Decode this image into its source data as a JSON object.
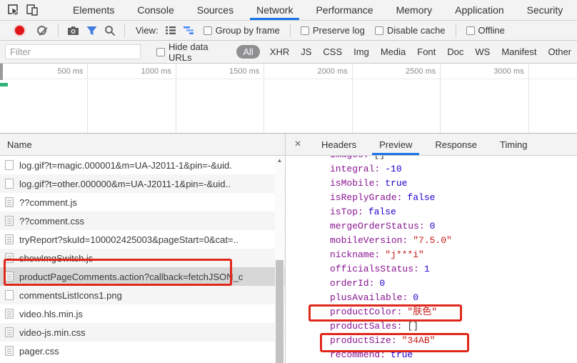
{
  "devtools": {
    "top_tabs": {
      "items": [
        {
          "label": "Elements",
          "state": ""
        },
        {
          "label": "Console",
          "state": ""
        },
        {
          "label": "Sources",
          "state": ""
        },
        {
          "label": "Network",
          "state": "active"
        },
        {
          "label": "Performance",
          "state": ""
        },
        {
          "label": "Memory",
          "state": ""
        },
        {
          "label": "Application",
          "state": ""
        },
        {
          "label": "Security",
          "state": ""
        }
      ]
    },
    "toolbar": {
      "view_label": "View:",
      "group_by_frame": "Group by frame",
      "preserve_log": "Preserve log",
      "disable_cache": "Disable cache",
      "offline": "Offline"
    },
    "filter_bar": {
      "placeholder": "Filter",
      "hide_data_urls": "Hide data URLs",
      "types": {
        "items": [
          {
            "label": "All",
            "state": "active-pill"
          },
          {
            "label": "XHR",
            "state": ""
          },
          {
            "label": "JS",
            "state": ""
          },
          {
            "label": "CSS",
            "state": ""
          },
          {
            "label": "Img",
            "state": ""
          },
          {
            "label": "Media",
            "state": ""
          },
          {
            "label": "Font",
            "state": ""
          },
          {
            "label": "Doc",
            "state": ""
          },
          {
            "label": "WS",
            "state": ""
          },
          {
            "label": "Manifest",
            "state": ""
          },
          {
            "label": "Other",
            "state": ""
          }
        ]
      }
    },
    "timeline": {
      "labels": {
        "items": [
          "500 ms",
          "1000 ms",
          "1500 ms",
          "2000 ms",
          "2500 ms",
          "3000 ms"
        ]
      }
    },
    "requests": {
      "header": "Name",
      "scroll_up_glyph": "▲",
      "items": [
        {
          "name": "log.gif?t=magic.000001&m=UA-J2011-1&pin=-&uid.",
          "icon": "img",
          "state": ""
        },
        {
          "name": "log.gif?t=other.000000&m=UA-J2011-1&pin=-&uid..",
          "icon": "img",
          "state": ""
        },
        {
          "name": "??comment.js",
          "icon": "doc",
          "state": ""
        },
        {
          "name": "??comment.css",
          "icon": "doc",
          "state": ""
        },
        {
          "name": "tryReport?skuId=100002425003&pageStart=0&cat=..",
          "icon": "doc",
          "state": ""
        },
        {
          "name": "showImgSwitch.js",
          "icon": "doc",
          "state": ""
        },
        {
          "name": "productPageComments.action?callback=fetchJSON_c",
          "icon": "doc",
          "state": "selected"
        },
        {
          "name": "commentsListIcons1.png",
          "icon": "img",
          "state": ""
        },
        {
          "name": "video.hls.min.js",
          "icon": "doc",
          "state": ""
        },
        {
          "name": "video-js.min.css",
          "icon": "doc",
          "state": ""
        },
        {
          "name": "pager.css",
          "icon": "doc",
          "state": ""
        }
      ]
    },
    "details": {
      "close_glyph": "×",
      "tabs": {
        "items": [
          {
            "label": "Headers",
            "state": ""
          },
          {
            "label": "Preview",
            "state": "active"
          },
          {
            "label": "Response",
            "state": ""
          },
          {
            "label": "Timing",
            "state": ""
          }
        ]
      },
      "preview": {
        "lines": [
          {
            "key": "images:",
            "value": "[]",
            "type": "arr"
          },
          {
            "key": "integral:",
            "value": "-10",
            "type": "num"
          },
          {
            "key": "isMobile:",
            "value": "true",
            "type": "bool"
          },
          {
            "key": "isReplyGrade:",
            "value": "false",
            "type": "bool"
          },
          {
            "key": "isTop:",
            "value": "false",
            "type": "bool"
          },
          {
            "key": "mergeOrderStatus:",
            "value": "0",
            "type": "num"
          },
          {
            "key": "mobileVersion:",
            "value": "\"7.5.0\"",
            "type": "str"
          },
          {
            "key": "nickname:",
            "value": "\"j***i\"",
            "type": "str"
          },
          {
            "key": "officialsStatus:",
            "value": "1",
            "type": "num"
          },
          {
            "key": "orderId:",
            "value": "0",
            "type": "num"
          },
          {
            "key": "plusAvailable:",
            "value": "0",
            "type": "num"
          },
          {
            "key": "productColor:",
            "value": "\"肤色\"",
            "type": "str"
          },
          {
            "key": "productSales:",
            "value": "[]",
            "type": "arr"
          },
          {
            "key": "productSize:",
            "value": "\"34AB\"",
            "type": "str"
          },
          {
            "key": "recommend:",
            "value": "true",
            "type": "bool"
          }
        ]
      }
    },
    "colors": {
      "accent_blue": "#1a73e8",
      "annotation_red": "#e0271c",
      "selected_row": "#d7d7d7",
      "json_key": "#881391",
      "json_number": "#1c00cf",
      "json_string": "#c41a16",
      "record_red": "#e01616",
      "waterfall_green": "#2fb277"
    }
  }
}
